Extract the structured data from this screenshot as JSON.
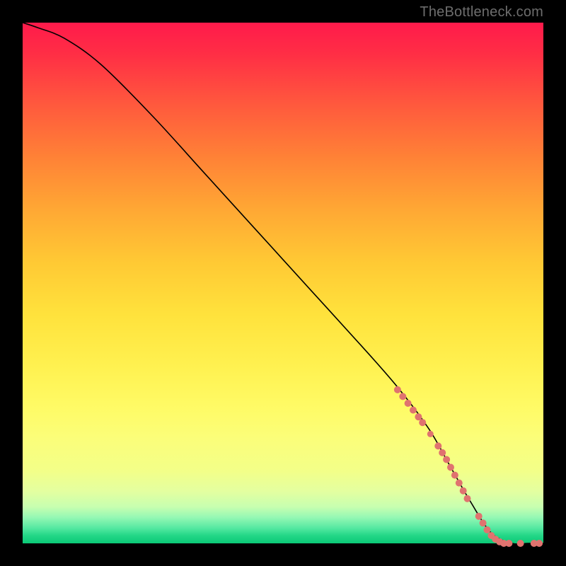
{
  "watermark": "TheBottleneck.com",
  "chart_data": {
    "type": "line",
    "title": "",
    "xlabel": "",
    "ylabel": "",
    "xlim": [
      0,
      100
    ],
    "ylim": [
      0,
      100
    ],
    "series": [
      {
        "name": "curve",
        "x": [
          0,
          3,
          8,
          15,
          25,
          35,
          45,
          55,
          65,
          72,
          78,
          82,
          86,
          90,
          94,
          97,
          100
        ],
        "y": [
          100,
          99,
          97,
          92,
          82,
          71,
          60,
          49,
          38,
          30,
          22,
          15,
          8,
          2,
          0,
          0,
          0
        ]
      }
    ],
    "markers": {
      "name": "dots",
      "color": "#e0736f",
      "points": [
        {
          "x": 72.0,
          "y": 29.5,
          "r": 5
        },
        {
          "x": 73.0,
          "y": 28.2,
          "r": 5
        },
        {
          "x": 74.0,
          "y": 26.9,
          "r": 5
        },
        {
          "x": 75.0,
          "y": 25.6,
          "r": 5
        },
        {
          "x": 76.0,
          "y": 24.3,
          "r": 5
        },
        {
          "x": 76.8,
          "y": 23.2,
          "r": 5
        },
        {
          "x": 78.3,
          "y": 21.0,
          "r": 4.5
        },
        {
          "x": 79.8,
          "y": 18.7,
          "r": 5
        },
        {
          "x": 80.6,
          "y": 17.4,
          "r": 5
        },
        {
          "x": 81.4,
          "y": 16.1,
          "r": 5
        },
        {
          "x": 82.2,
          "y": 14.6,
          "r": 5
        },
        {
          "x": 83.0,
          "y": 13.1,
          "r": 5
        },
        {
          "x": 83.8,
          "y": 11.6,
          "r": 5
        },
        {
          "x": 84.6,
          "y": 10.1,
          "r": 5
        },
        {
          "x": 85.4,
          "y": 8.6,
          "r": 5
        },
        {
          "x": 87.6,
          "y": 5.2,
          "r": 5
        },
        {
          "x": 88.4,
          "y": 3.9,
          "r": 5
        },
        {
          "x": 89.2,
          "y": 2.6,
          "r": 5
        },
        {
          "x": 90.0,
          "y": 1.5,
          "r": 5
        },
        {
          "x": 90.8,
          "y": 0.8,
          "r": 5
        },
        {
          "x": 91.6,
          "y": 0.3,
          "r": 5
        },
        {
          "x": 92.4,
          "y": 0.0,
          "r": 5
        },
        {
          "x": 93.4,
          "y": 0.0,
          "r": 5
        },
        {
          "x": 95.6,
          "y": 0.0,
          "r": 5
        },
        {
          "x": 98.2,
          "y": 0.0,
          "r": 5
        },
        {
          "x": 99.2,
          "y": 0.0,
          "r": 5
        }
      ]
    }
  }
}
